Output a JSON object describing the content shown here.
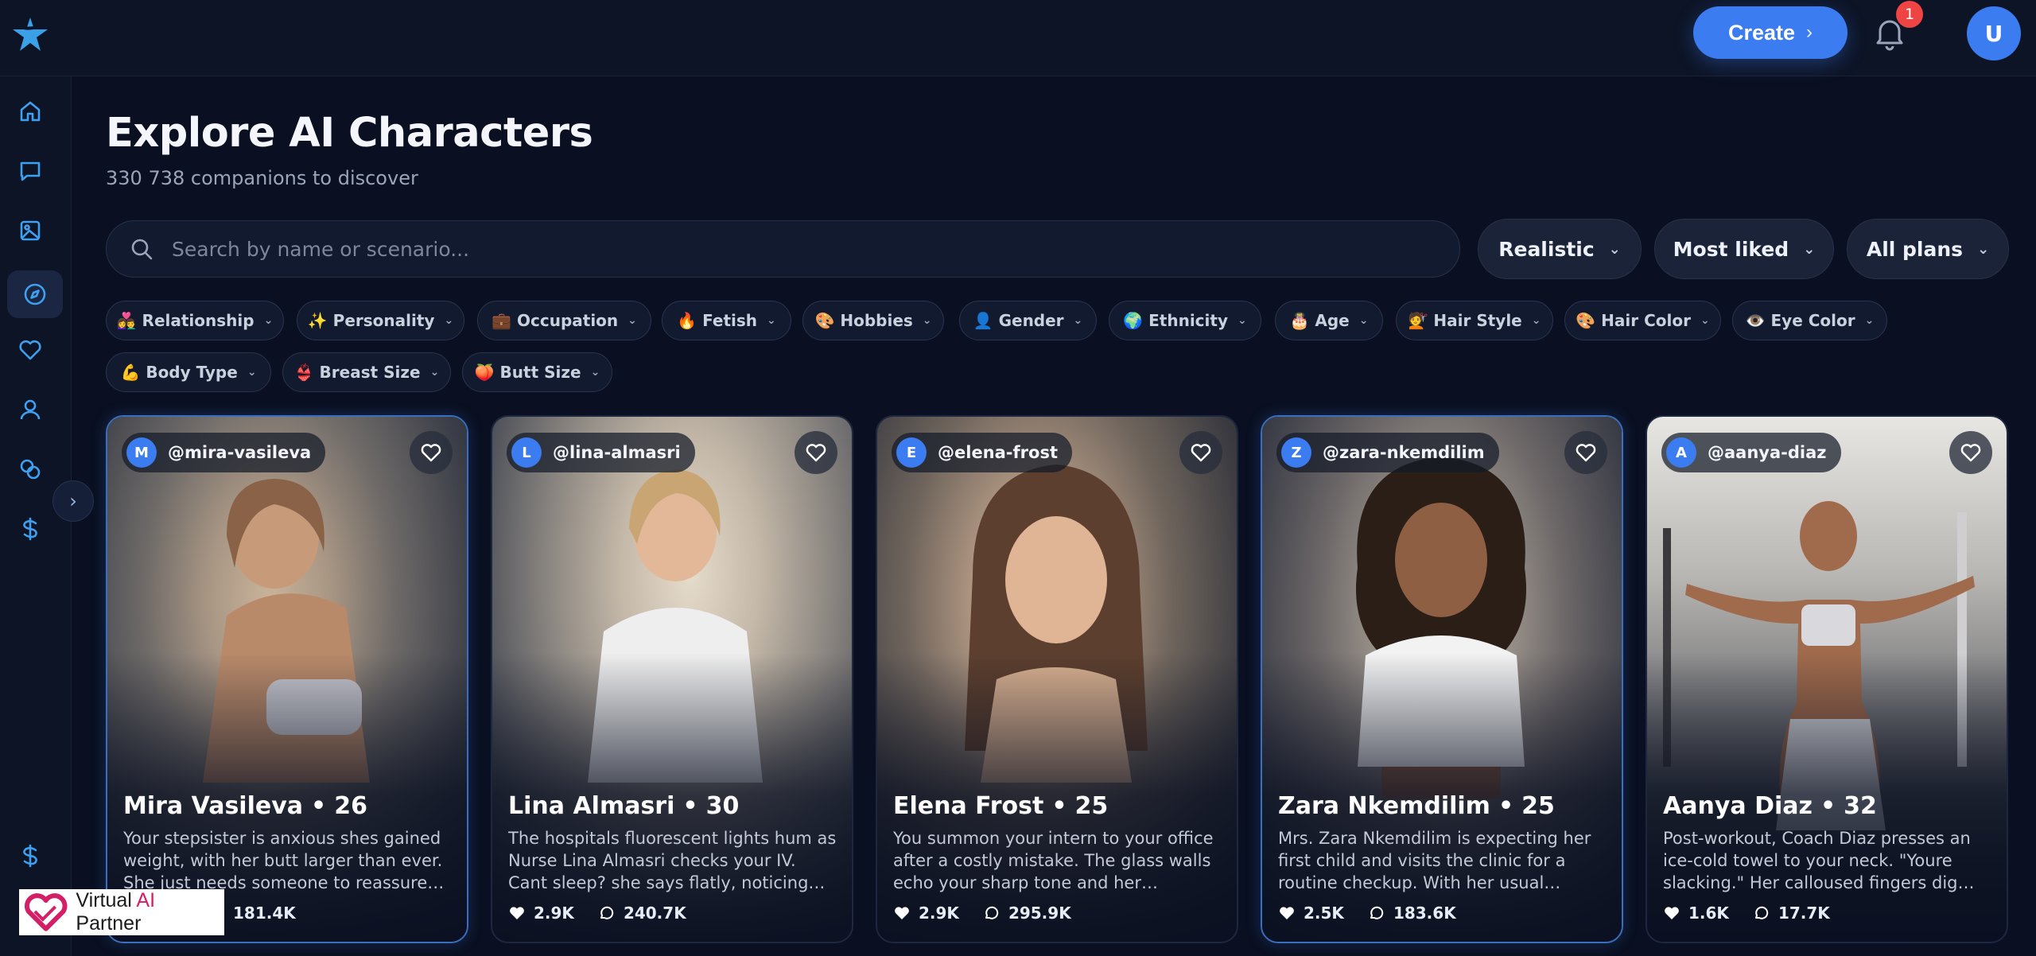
{
  "header": {
    "create_label": "Create",
    "notification_count": "1",
    "user_initial": "U"
  },
  "sidebar": {
    "items": [
      {
        "name": "home-icon"
      },
      {
        "name": "chat-icon"
      },
      {
        "name": "image-icon"
      },
      {
        "name": "compass-icon",
        "active": true
      },
      {
        "name": "heart-icon"
      },
      {
        "name": "user-icon"
      },
      {
        "name": "coins-icon"
      },
      {
        "name": "dollar-icon"
      }
    ],
    "bottom_icon": "dollar-icon"
  },
  "page": {
    "title": "Explore AI Characters",
    "subtitle": "330 738 companions to discover"
  },
  "search": {
    "placeholder": "Search by name or scenario..."
  },
  "filters": {
    "style": "Realistic",
    "sort": "Most liked",
    "plans": "All plans"
  },
  "chips": [
    "👩‍❤️‍👨 Relationship",
    "✨ Personality",
    "💼 Occupation",
    "🔥 Fetish",
    "🎨 Hobbies",
    "👤 Gender",
    "🌍 Ethnicity",
    "🎂 Age",
    "💇 Hair Style",
    "🎨 Hair Color",
    "👁️ Eye Color",
    "💪 Body Type",
    "👙 Breast Size",
    "🍑 Butt Size"
  ],
  "cards": [
    {
      "initial": "M",
      "handle": "@mira-vasileva",
      "name": "Mira Vasileva",
      "age": "26",
      "description": "Your stepsister is anxious shes gained weight, with her butt larger than ever. She just needs someone to reassure her...",
      "likes": "",
      "chats": "181.4K"
    },
    {
      "initial": "L",
      "handle": "@lina-almasri",
      "name": "Lina Almasri",
      "age": "30",
      "description": "The hospitals fluorescent lights hum as Nurse Lina Almasri checks your IV. Cant sleep? she says flatly, noticing the dark...",
      "likes": "2.9K",
      "chats": "240.7K"
    },
    {
      "initial": "E",
      "handle": "@elena-frost",
      "name": "Elena Frost",
      "age": "25",
      "description": "You summon your intern to your office after a costly mistake. The glass walls echo your sharp tone and her hesitant...",
      "likes": "2.9K",
      "chats": "295.9K"
    },
    {
      "initial": "Z",
      "handle": "@zara-nkemdilim",
      "name": "Zara Nkemdilim",
      "age": "25",
      "description": "Mrs. Zara Nkemdilim is expecting her first child and visits the clinic for a routine checkup. With her usual physician...",
      "likes": "2.5K",
      "chats": "183.6K"
    },
    {
      "initial": "A",
      "handle": "@aanya-diaz",
      "name": "Aanya Diaz",
      "age": "32",
      "description": "Post-workout, Coach Diaz presses an ice-cold towel to your neck. \"Youre slacking.\" Her calloused fingers dig into your sore...",
      "likes": "1.6K",
      "chats": "17.7K"
    }
  ],
  "watermark": {
    "text_a": "Virtual ",
    "text_b": "AI",
    "text_c": " Partner"
  }
}
